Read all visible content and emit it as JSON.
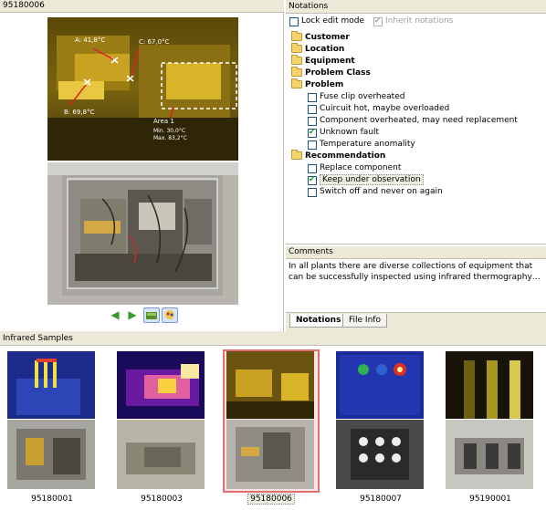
{
  "image_panel": {
    "title": "95180006",
    "ir_labels": {
      "a": "A: 41,8°C",
      "b": "B: 69,8°C",
      "c": "C: 67,0°C",
      "area_title": "Area 1",
      "area_min": "Min.  30,0°C",
      "area_max": "Max.  83,2°C"
    }
  },
  "notations": {
    "header": "Notations",
    "lock_edit_mode": {
      "label": "Lock edit mode",
      "checked": false
    },
    "inherit_notations": {
      "label": "Inherit notations",
      "checked": true,
      "disabled": true
    },
    "categories": [
      {
        "label": "Customer"
      },
      {
        "label": "Location"
      },
      {
        "label": "Equipment"
      },
      {
        "label": "Problem Class"
      }
    ],
    "problem": {
      "label": "Problem",
      "items": [
        {
          "label": "Fuse clip overheated",
          "checked": false
        },
        {
          "label": "Cuircuit hot, maybe overloaded",
          "checked": false
        },
        {
          "label": "Component overheated, may need replacement",
          "checked": false
        },
        {
          "label": "Unknown fault",
          "checked": true
        },
        {
          "label": "Temperature anomality",
          "checked": false
        }
      ]
    },
    "recommendation": {
      "label": "Recommendation",
      "items": [
        {
          "label": "Replace component",
          "checked": false
        },
        {
          "label": "Keep under observation",
          "checked": true,
          "selected": true
        },
        {
          "label": "Switch off and never on again",
          "checked": false
        }
      ]
    }
  },
  "comments": {
    "header": "Comments",
    "text": "In all plants there are diverse collections of equipment that can be successfully inspected using infrared thermography…"
  },
  "tabs": [
    {
      "label": "Notations",
      "active": true
    },
    {
      "label": "File Info",
      "active": false
    }
  ],
  "samples": {
    "header": "Infrared Samples",
    "items": [
      {
        "label": "95180001",
        "selected": false
      },
      {
        "label": "95180003",
        "selected": false
      },
      {
        "label": "95180006",
        "selected": true
      },
      {
        "label": "95180007",
        "selected": false
      },
      {
        "label": "95190001",
        "selected": false
      }
    ]
  },
  "colors": {
    "accent_selected": "#e06f6f",
    "header_bg": "#ece9d8",
    "check_green": "#21a121"
  }
}
